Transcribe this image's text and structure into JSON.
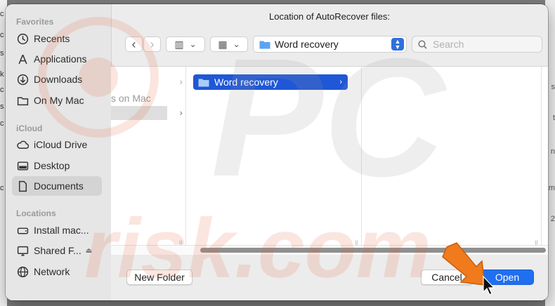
{
  "background": {
    "left_fragments": [
      "c",
      "c",
      "s",
      "k",
      "c",
      "s",
      "c",
      "r",
      "a",
      "c"
    ],
    "right_fragments": [
      "s",
      "t",
      "n",
      "2m",
      "2"
    ]
  },
  "dialog": {
    "title": "Location of AutoRecover files:"
  },
  "sidebar": {
    "favorites_header": "Favorites",
    "favorites": [
      {
        "label": "Recents",
        "icon": "clock-icon"
      },
      {
        "label": "Applications",
        "icon": "applications-icon"
      },
      {
        "label": "Downloads",
        "icon": "download-icon"
      },
      {
        "label": "On My Mac",
        "icon": "folder-icon"
      }
    ],
    "icloud_header": "iCloud",
    "icloud": [
      {
        "label": "iCloud Drive",
        "icon": "cloud-icon"
      },
      {
        "label": "Desktop",
        "icon": "desktop-icon"
      },
      {
        "label": "Documents",
        "icon": "document-icon",
        "selected": true
      }
    ],
    "locations_header": "Locations",
    "locations": [
      {
        "label": "Install mac...",
        "icon": "disk-icon"
      },
      {
        "label": "Shared F...",
        "icon": "display-icon",
        "eject": "⏏"
      },
      {
        "label": "Network",
        "icon": "globe-icon"
      }
    ]
  },
  "toolbar": {
    "back": "‹",
    "forward": "›",
    "view_columns": "▥",
    "view_grid": "▦",
    "dropdown": "⌄",
    "location_value": "Word recovery",
    "search_placeholder": "Search"
  },
  "browser": {
    "first_column_text": "s on Mac",
    "selected_item": "Word recovery",
    "chevron": "›"
  },
  "footer": {
    "new_folder": "New Folder",
    "cancel": "Cancel",
    "open": "Open"
  },
  "watermark": {
    "text_top": "PC",
    "text_bottom": "risk.com"
  },
  "colors": {
    "accent": "#1f57d6",
    "primary_button": "#1f6ff0",
    "arrow": "#f07a1c"
  }
}
